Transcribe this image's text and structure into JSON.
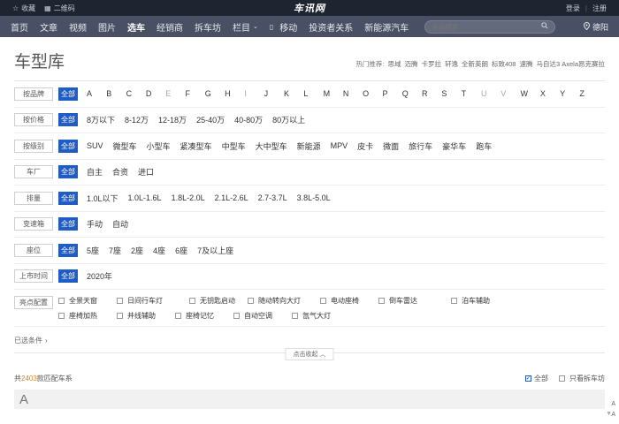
{
  "topbar": {
    "favorite": "收藏",
    "qrcode": "二维码",
    "logo": "车讯网",
    "login": "登录",
    "separator": "|",
    "register": "注册"
  },
  "nav": {
    "items": [
      "首页",
      "文章",
      "视频",
      "图片",
      "选车",
      "经销商",
      "拆车坊",
      "栏目",
      "移动",
      "投资者关系",
      "新能源汽车"
    ],
    "active_index": 4,
    "search_placeholder": "全站搜索",
    "location": "德阳"
  },
  "page": {
    "title": "车型库",
    "hot_label": "热门推荐:",
    "hot_items": [
      "思域",
      "迈腾",
      "卡罗拉",
      "轩逸",
      "全新英朗",
      "标致408",
      "速腾",
      "马自达3 Axela昂克赛拉"
    ]
  },
  "filters": {
    "all_label": "全部",
    "brand": {
      "label": "按品牌",
      "letters": [
        "A",
        "B",
        "C",
        "D",
        "E",
        "F",
        "G",
        "H",
        "I",
        "J",
        "K",
        "L",
        "M",
        "N",
        "O",
        "P",
        "Q",
        "R",
        "S",
        "T",
        "U",
        "V",
        "W",
        "X",
        "Y",
        "Z"
      ],
      "dim_letters": [
        "E",
        "I",
        "U",
        "V"
      ]
    },
    "price": {
      "label": "按价格",
      "options": [
        "8万以下",
        "8-12万",
        "12-18万",
        "25-40万",
        "40-80万",
        "80万以上"
      ]
    },
    "level": {
      "label": "按级别",
      "options": [
        "SUV",
        "微型车",
        "小型车",
        "紧凑型车",
        "中型车",
        "大中型车",
        "新能源",
        "MPV",
        "皮卡",
        "微面",
        "旅行车",
        "豪华车",
        "跑车"
      ]
    },
    "maker": {
      "label": "车厂",
      "options": [
        "自主",
        "合资",
        "进口"
      ]
    },
    "displacement": {
      "label": "排量",
      "options": [
        "1.0L以下",
        "1.0L-1.6L",
        "1.8L-2.0L",
        "2.1L-2.6L",
        "2.7-3.7L",
        "3.8L-5.0L"
      ]
    },
    "gearbox": {
      "label": "变速箱",
      "options": [
        "手动",
        "自动"
      ]
    },
    "seats": {
      "label": "座位",
      "options": [
        "5座",
        "7座",
        "2座",
        "4座",
        "6座",
        "7及以上座"
      ]
    },
    "year": {
      "label": "上市时间",
      "options": [
        "2020年"
      ]
    },
    "features": {
      "label": "亮点配置",
      "options": [
        "全景天窗",
        "日间行车灯",
        "无钥匙启动",
        "随动转向大灯",
        "电动座椅",
        "倒车雷达",
        "泊车辅助",
        "座椅加热",
        "并线辅助",
        "座椅记忆",
        "自动空调",
        "氙气大灯"
      ]
    }
  },
  "selected": {
    "label": "已选条件",
    "arrow": "›"
  },
  "collapse": {
    "label": "点击收起",
    "arrow": "︿"
  },
  "results": {
    "prefix": "共",
    "count": "2403",
    "suffix": "款匹配车系",
    "filter_all": "全部",
    "filter_demolition": "只看拆车坊"
  },
  "list": {
    "first_letter": "A"
  },
  "side_index": [
    "A",
    "A"
  ]
}
